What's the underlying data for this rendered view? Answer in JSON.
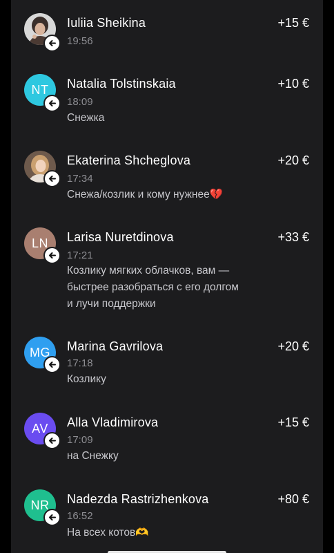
{
  "transactions": [
    {
      "name": "Iuliia Sheikina",
      "time": "19:56",
      "amount": "+15 €",
      "message": "",
      "avatar": {
        "type": "photo",
        "initials": "",
        "color": "#6b5a52"
      },
      "badge_icon": "arrow-left-icon"
    },
    {
      "name": "Natalia Tolstinskaia",
      "time": "18:09",
      "amount": "+10 €",
      "message": "Снежка",
      "avatar": {
        "type": "initials",
        "initials": "NT",
        "color": "#2ec8e0"
      },
      "badge_icon": "arrow-left-icon"
    },
    {
      "name": "Ekaterina Shcheglova",
      "time": "17:34",
      "amount": "+20 €",
      "message": "Снежа/козлик и кому нужнее💔",
      "avatar": {
        "type": "photo",
        "initials": "",
        "color": "#c9a27a"
      },
      "badge_icon": "arrow-left-icon"
    },
    {
      "name": "Larisa Nuretdinova",
      "time": "17:21",
      "amount": "+33 €",
      "message": "Козлику мягких облачков, вам —\nбыстрее разобраться с его долгом\nи лучи поддержки",
      "avatar": {
        "type": "initials",
        "initials": "LN",
        "color": "#a97f70"
      },
      "badge_icon": "arrow-left-icon"
    },
    {
      "name": "Marina Gavrilova",
      "time": "17:18",
      "amount": "+20 €",
      "message": "Козлику",
      "avatar": {
        "type": "initials",
        "initials": "MG",
        "color": "#2f9ff0"
      },
      "badge_icon": "arrow-left-icon"
    },
    {
      "name": "Alla Vladimirova",
      "time": "17:09",
      "amount": "+15 €",
      "message": "на Снежку",
      "avatar": {
        "type": "initials",
        "initials": "AV",
        "color": "#6a4cf0"
      },
      "badge_icon": "arrow-left-icon"
    },
    {
      "name": "Nadezda Rastrizhenkova",
      "time": "16:52",
      "amount": "+80 €",
      "message": "На всех котов🫶",
      "avatar": {
        "type": "initials",
        "initials": "NR",
        "color": "#1fbf8f"
      },
      "badge_icon": "arrow-left-icon"
    }
  ],
  "colors": {
    "background": "#000000",
    "panel": "#1c1c1e",
    "primary_text": "#ffffff",
    "secondary_text": "#8e8e93",
    "message_text": "#c7c7cc"
  }
}
